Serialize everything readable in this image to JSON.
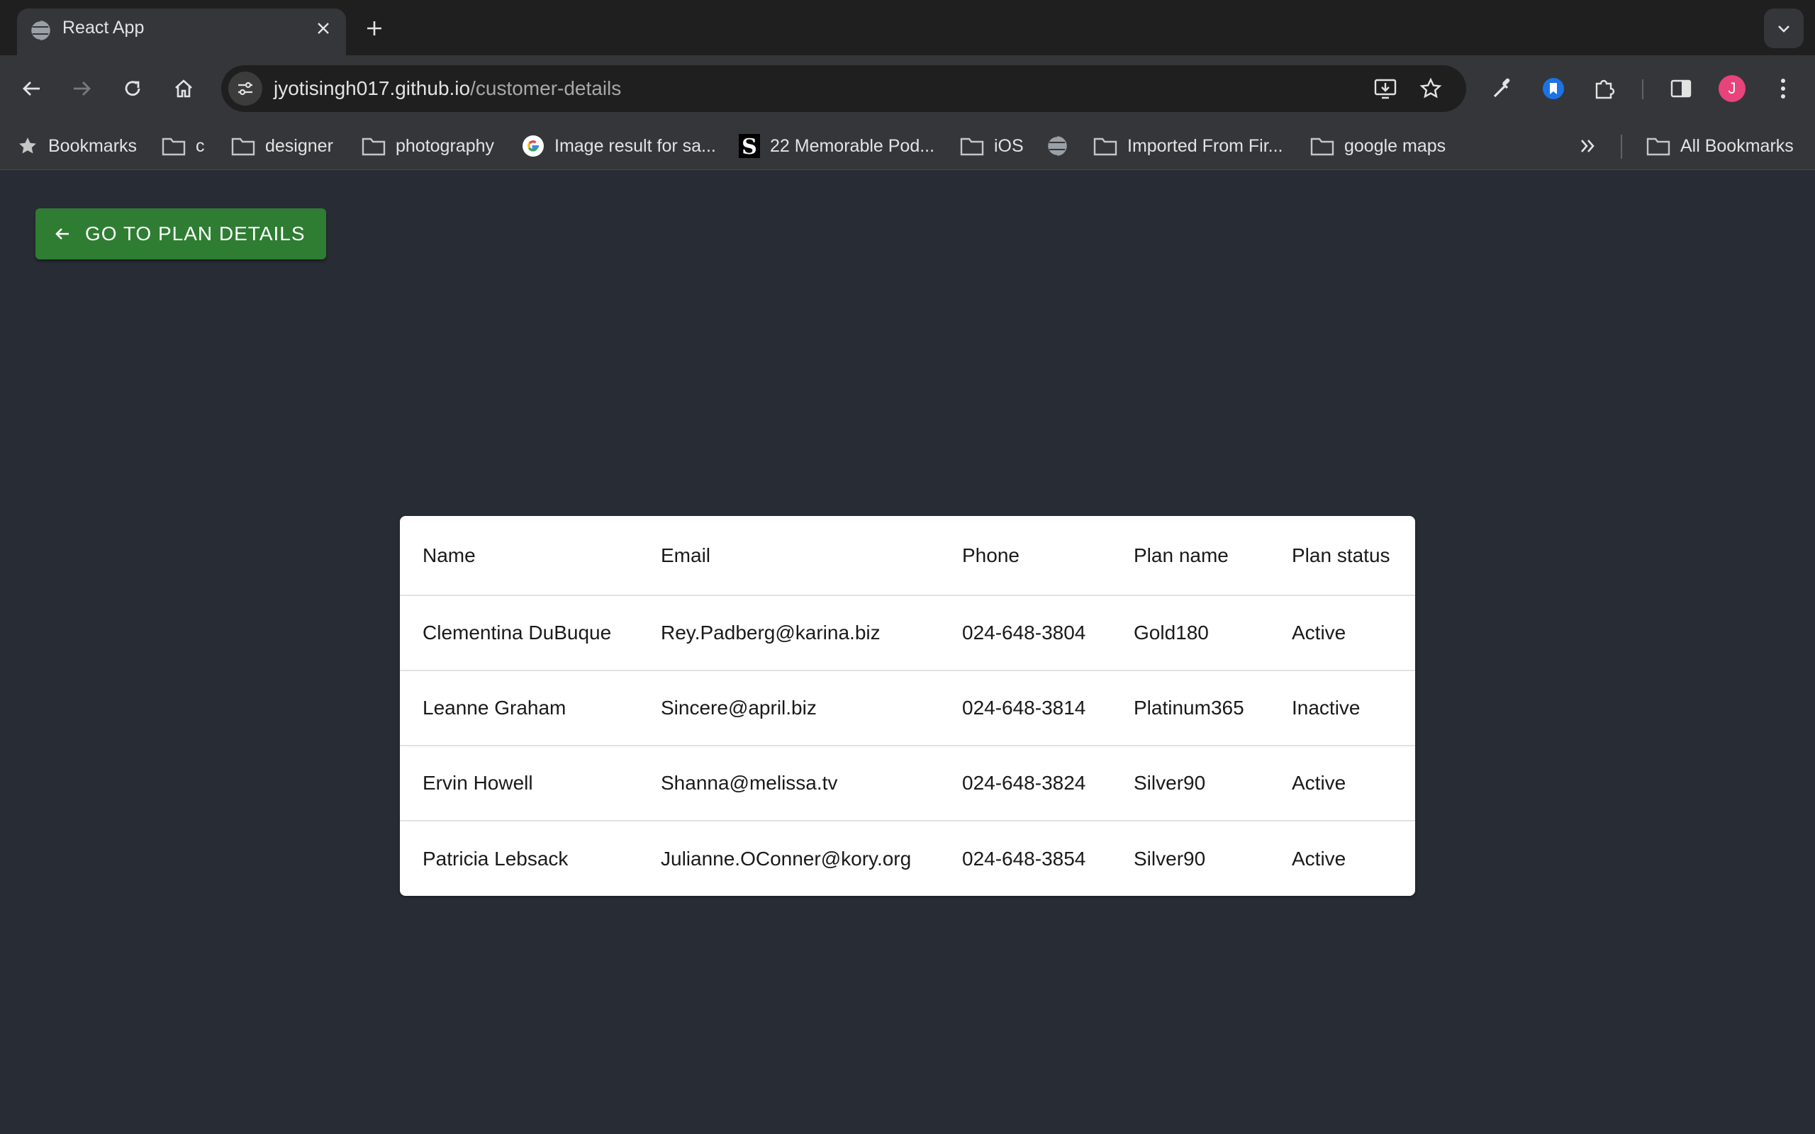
{
  "browser": {
    "tab_title": "React App",
    "url_host": "jyotisingh017.github.io",
    "url_path": "/customer-details",
    "profile_initial": "J",
    "profile_color": "#e8437a",
    "extension_color": "#1a73e8",
    "icons": {
      "back": "arrow-left-icon",
      "forward": "arrow-right-icon",
      "reload": "reload-icon",
      "home": "home-icon",
      "install": "install-app-icon",
      "bookmark_star": "star-icon",
      "eyedropper": "eyedropper-icon",
      "extensions": "puzzle-icon",
      "side_panel": "side-panel-icon",
      "menu": "kebab-menu-icon"
    }
  },
  "bookmarks": {
    "items": [
      {
        "label": "Bookmarks",
        "icon": "star-icon"
      },
      {
        "label": "c",
        "icon": "folder-icon"
      },
      {
        "label": "designer",
        "icon": "folder-icon"
      },
      {
        "label": "photography",
        "icon": "folder-icon"
      },
      {
        "label": "Image result for sa...",
        "icon": "google-icon"
      },
      {
        "label": "22 Memorable Pod...",
        "icon": "site-s-icon"
      },
      {
        "label": "iOS",
        "icon": "folder-icon"
      },
      {
        "label": "",
        "icon": "globe-icon"
      },
      {
        "label": "Imported From Fir...",
        "icon": "folder-icon"
      },
      {
        "label": "google maps",
        "icon": "folder-icon"
      }
    ],
    "all_bookmarks": "All Bookmarks"
  },
  "page": {
    "back_button_label": "GO TO PLAN DETAILS",
    "accent_color": "#2e7d32",
    "background_color": "#282c34"
  },
  "table": {
    "headers": [
      "Name",
      "Email",
      "Phone",
      "Plan name",
      "Plan status"
    ],
    "rows": [
      [
        "Clementina DuBuque",
        "Rey.Padberg@karina.biz",
        "024-648-3804",
        "Gold180",
        "Active"
      ],
      [
        "Leanne Graham",
        "Sincere@april.biz",
        "024-648-3814",
        "Platinum365",
        "Inactive"
      ],
      [
        "Ervin Howell",
        "Shanna@melissa.tv",
        "024-648-3824",
        "Silver90",
        "Active"
      ],
      [
        "Patricia Lebsack",
        "Julianne.OConner@kory.org",
        "024-648-3854",
        "Silver90",
        "Active"
      ]
    ]
  }
}
